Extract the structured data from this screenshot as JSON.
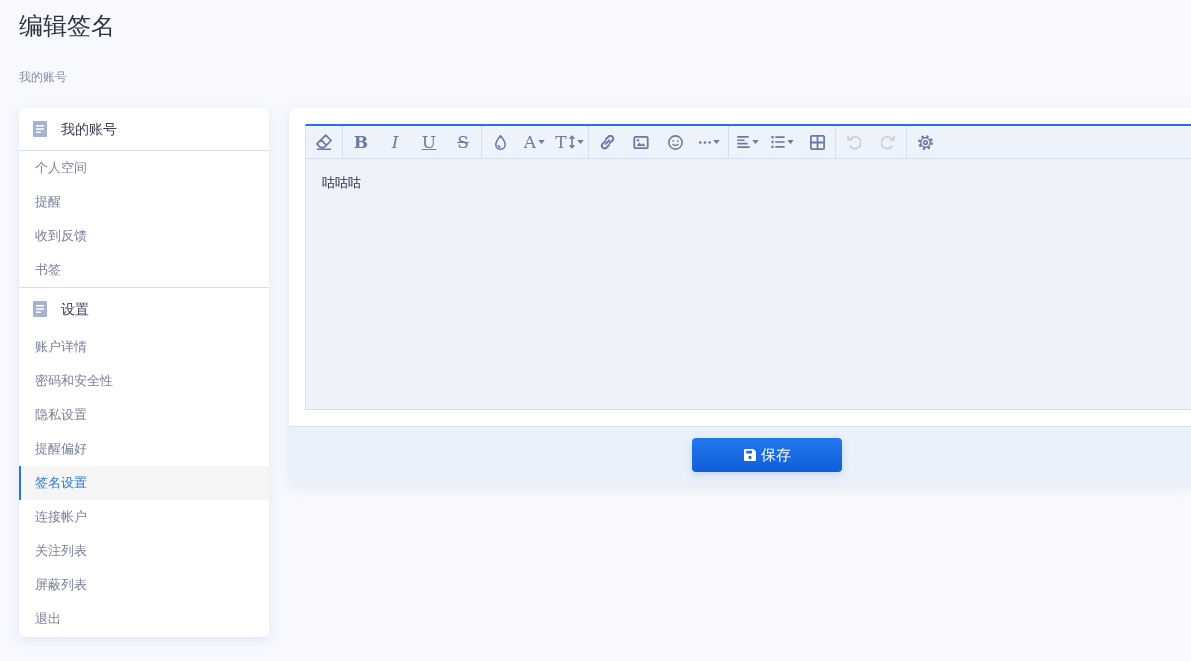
{
  "page": {
    "title": "编辑签名",
    "breadcrumb": "我的账号"
  },
  "sidebar": {
    "sections": [
      {
        "title": "我的账号",
        "items": [
          {
            "label": "个人空间",
            "selected": false
          },
          {
            "label": "提醒",
            "selected": false
          },
          {
            "label": "收到反馈",
            "selected": false
          },
          {
            "label": "书签",
            "selected": false
          }
        ]
      },
      {
        "title": "设置",
        "items": [
          {
            "label": "账户详情",
            "selected": false
          },
          {
            "label": "密码和安全性",
            "selected": false
          },
          {
            "label": "隐私设置",
            "selected": false
          },
          {
            "label": "提醒偏好",
            "selected": false
          },
          {
            "label": "签名设置",
            "selected": true
          },
          {
            "label": "连接帐户",
            "selected": false
          },
          {
            "label": "关注列表",
            "selected": false
          },
          {
            "label": "屏蔽列表",
            "selected": false
          },
          {
            "label": "退出",
            "selected": false
          }
        ]
      }
    ]
  },
  "editor": {
    "toolbar": {
      "groups": [
        {
          "items": [
            {
              "kind": "eraser",
              "disabled": false,
              "caret": false
            }
          ]
        },
        {
          "items": [
            {
              "kind": "bold",
              "label": "B",
              "disabled": false,
              "caret": false
            },
            {
              "kind": "italic",
              "label": "I",
              "disabled": false,
              "caret": false
            },
            {
              "kind": "underline",
              "label": "U",
              "disabled": false,
              "caret": false
            },
            {
              "kind": "strike",
              "label": "S",
              "disabled": false,
              "caret": false
            }
          ]
        },
        {
          "items": [
            {
              "kind": "droplet",
              "disabled": false,
              "caret": false
            },
            {
              "kind": "font",
              "label": "A",
              "disabled": false,
              "caret": true
            },
            {
              "kind": "size",
              "label": "T",
              "disabled": false,
              "caret": true
            }
          ]
        },
        {
          "items": [
            {
              "kind": "link",
              "disabled": false,
              "caret": false
            },
            {
              "kind": "image",
              "disabled": false,
              "caret": false
            },
            {
              "kind": "smiley",
              "disabled": false,
              "caret": false
            },
            {
              "kind": "more",
              "disabled": false,
              "caret": true
            }
          ]
        },
        {
          "items": [
            {
              "kind": "align",
              "disabled": false,
              "caret": true
            },
            {
              "kind": "list",
              "disabled": false,
              "caret": true
            },
            {
              "kind": "table",
              "disabled": false,
              "caret": false
            }
          ]
        },
        {
          "items": [
            {
              "kind": "undo",
              "disabled": true,
              "caret": false
            },
            {
              "kind": "redo",
              "disabled": true,
              "caret": false
            }
          ]
        },
        {
          "items": [
            {
              "kind": "gear",
              "disabled": false,
              "caret": false
            }
          ]
        }
      ]
    },
    "content": "咕咕咕"
  },
  "save_button": {
    "label": "保存"
  }
}
